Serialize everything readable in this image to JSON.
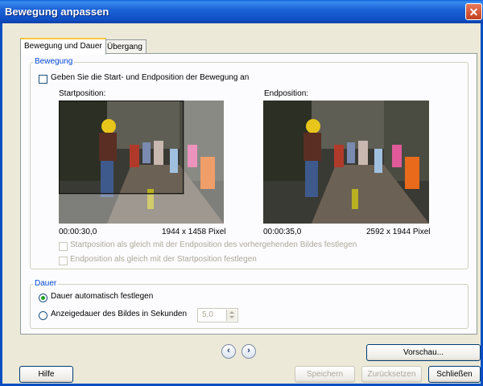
{
  "window": {
    "title": "Bewegung anpassen"
  },
  "tabs": [
    {
      "label": "Bewegung und Dauer"
    },
    {
      "label": "Übergang"
    }
  ],
  "bewegung": {
    "group_label": "Bewegung",
    "checkbox_label": "Geben Sie die Start- und Endposition der Bewegung an",
    "start": {
      "label": "Startposition:",
      "time": "00:00:30,0",
      "size": "1944 x 1458 Pixel"
    },
    "end": {
      "label": "Endposition:",
      "time": "00:00:35,0",
      "size": "2592 x 1944 Pixel"
    },
    "option_start_equal": "Startposition als gleich mit der Endposition des vorhergehenden Bildes festlegen",
    "option_end_equal": "Endposition als gleich mit der Startposition festlegen"
  },
  "dauer": {
    "group_label": "Dauer",
    "auto_label": "Dauer automatisch festlegen",
    "manual_label": "Anzeigedauer des Bildes in Sekunden",
    "seconds_value": "5,0"
  },
  "buttons": {
    "preview": "Vorschau...",
    "help": "Hilfe",
    "save": "Speichern",
    "reset": "Zurücksetzen",
    "close": "Schließen"
  },
  "colors": {
    "accent": "#0046D5",
    "titlebar": "#0A5FD8"
  }
}
